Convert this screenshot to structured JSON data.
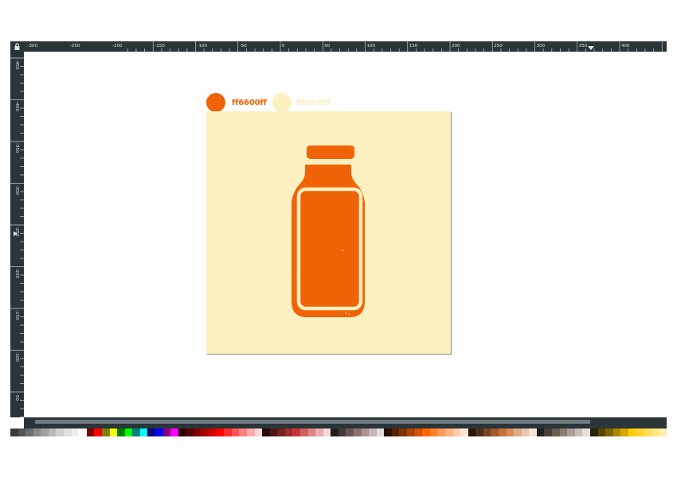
{
  "window": {
    "title": ""
  },
  "colors": {
    "primary": "#f06306",
    "background": "#fdf0c0",
    "chrome": "#2a353a"
  },
  "rulers": {
    "horizontal_labels": [
      "-300",
      "-250",
      "-200",
      "-150",
      "-100",
      "-50",
      "0",
      "50",
      "100",
      "150",
      "200",
      "250",
      "300",
      "350",
      "400"
    ],
    "vertical_labels": [
      "-450",
      "-400",
      "-350",
      "-300",
      "-250",
      "-200",
      "-150",
      "-100",
      "-50",
      "0",
      "50"
    ]
  },
  "swatches": [
    {
      "name": "ff6600ff",
      "color": "#f06306"
    },
    {
      "name": "fdefc0ff",
      "color": "#fdf0c0"
    }
  ],
  "icons": {
    "lock": "lock-icon",
    "bottle": "bottle-icon",
    "guide_marker": "guide-marker-icon"
  },
  "palette": [
    "#3a3a3a",
    "#555555",
    "#6e6e6e",
    "#888888",
    "#a0a0a0",
    "#b8b8b8",
    "#cfcfcf",
    "#e2e2e2",
    "#f0f0f0",
    "#ffffff",
    "#800000",
    "#ff0000",
    "#808000",
    "#ffff00",
    "#008000",
    "#00ff00",
    "#008080",
    "#00ffff",
    "#000080",
    "#0000ff",
    "#800080",
    "#ff00ff",
    "#2b0000",
    "#550000",
    "#800000",
    "#aa0000",
    "#d40000",
    "#ff0000",
    "#ff2a2a",
    "#ff5555",
    "#ff8080",
    "#ffaaaa",
    "#ffd5d5",
    "#280b0b",
    "#501616",
    "#782121",
    "#a02c2c",
    "#c83737",
    "#d35f5f",
    "#de8787",
    "#e9afaf",
    "#f4d7d7",
    "#241c1c",
    "#483737",
    "#6c5353",
    "#916f6f",
    "#ac9393",
    "#c8b7b7",
    "#e3dbdb",
    "#2b1100",
    "#552200",
    "#803300",
    "#aa4400",
    "#d45500",
    "#ff6600",
    "#ff7f2a",
    "#ff9955",
    "#ffb380",
    "#ffccaa",
    "#ffe6d5",
    "#28170b",
    "#502d16",
    "#784421",
    "#a05a2c",
    "#c87137",
    "#d38d5f",
    "#deaa87",
    "#e9c6af",
    "#f4e3d7",
    "#241f1c",
    "#483e37",
    "#6c5d53",
    "#917c6f",
    "#ac9d93",
    "#c8beb7",
    "#e3dedb",
    "#2b2200",
    "#554400",
    "#806600",
    "#aa8800",
    "#d4aa00",
    "#ffcc00",
    "#ffd42a",
    "#ffdd55",
    "#ffe680",
    "#ffeeaa"
  ]
}
